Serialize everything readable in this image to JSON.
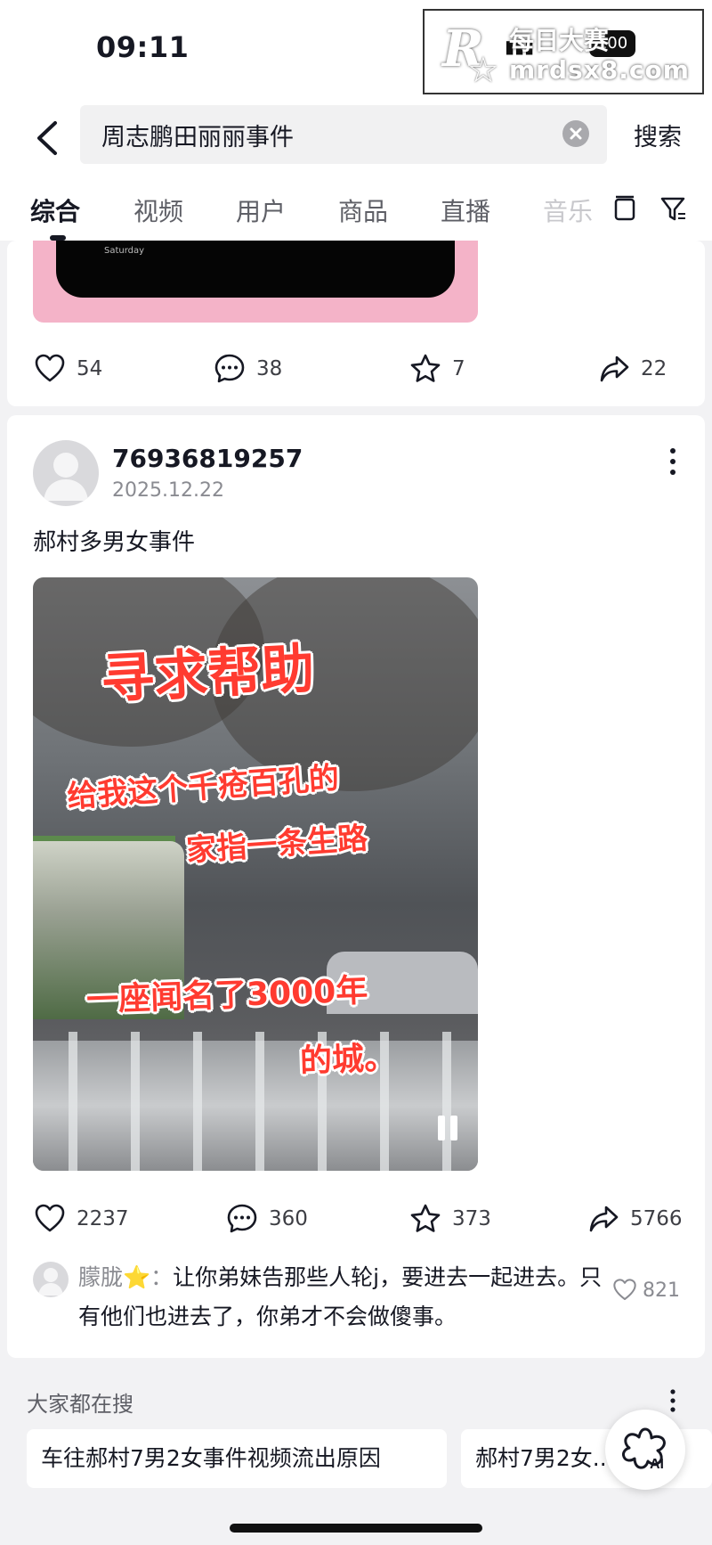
{
  "status": {
    "time": "09:11",
    "battery": "100"
  },
  "watermark": {
    "logo": "R",
    "cn": "每日大赛",
    "site": "mrdsx8.com"
  },
  "search": {
    "query": "周志鹏田丽丽事件",
    "button": "搜索"
  },
  "tabs": [
    "综合",
    "视频",
    "用户",
    "商品",
    "直播",
    "音乐"
  ],
  "post1": {
    "thumb_text": "Saturday",
    "likes": "54",
    "comments": "38",
    "favorites": "7",
    "shares": "22"
  },
  "post2": {
    "username": "76936819257",
    "date": "2025.12.22",
    "title": "郝村多男女事件",
    "video_text": {
      "line1": "寻求帮助",
      "line2": "给我这个千疮百孔的",
      "line3": "家指一条生路",
      "line4": "一座闻名了3000年",
      "line5": "的城。"
    },
    "likes": "2237",
    "comments": "360",
    "favorites": "373",
    "shares": "5766",
    "top_comment": {
      "user": "朦胧⭐️",
      "text": "让你弟妹告那些人轮j，要进去一起进去。只有他们也进去了，你弟才不会做傻事。",
      "likes": "821"
    }
  },
  "hot_searches": {
    "title": "大家都在搜",
    "items": [
      "车往郝村7男2女事件视频流出原因",
      "郝村7男2女..."
    ]
  },
  "colors": {
    "accent_pink": "#f4b3c8",
    "video_text_red": "#ff3b30"
  }
}
